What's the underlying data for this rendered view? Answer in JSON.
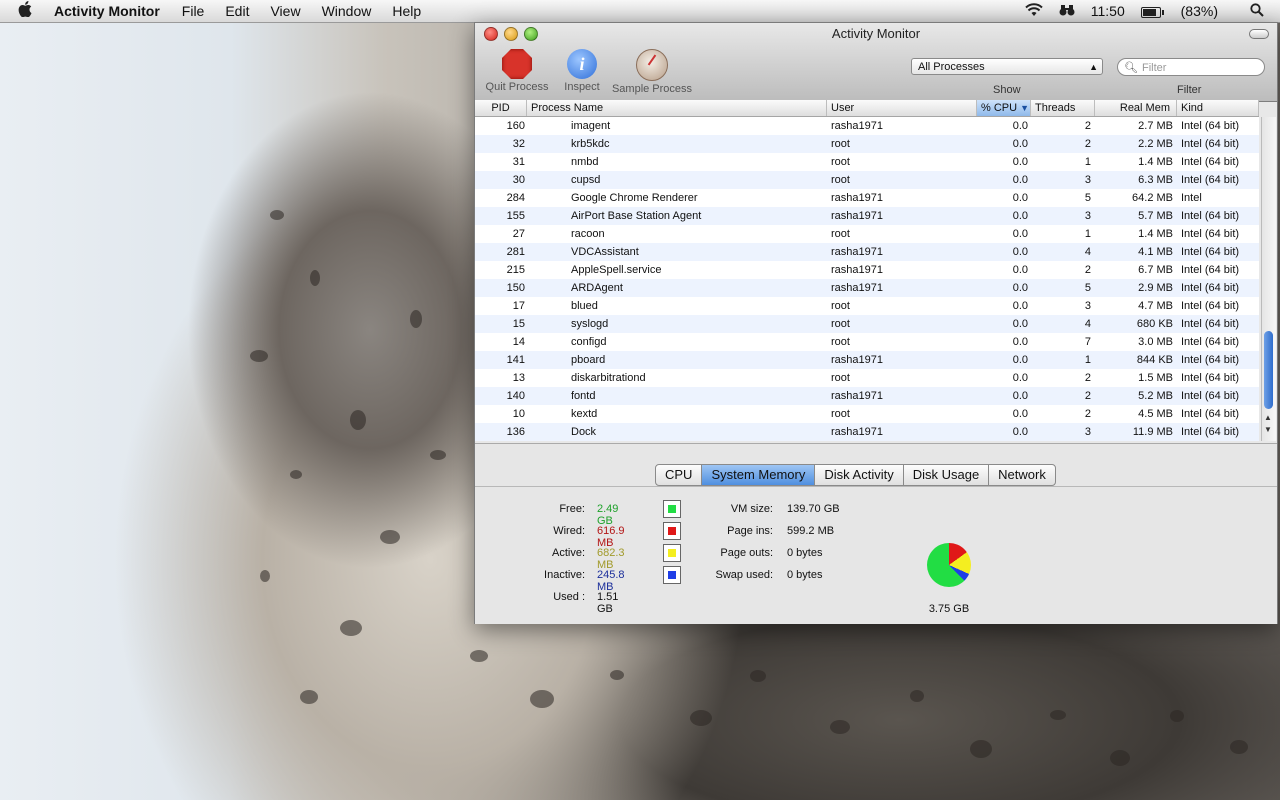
{
  "menubar": {
    "app": "Activity Monitor",
    "menus": [
      "File",
      "Edit",
      "View",
      "Window",
      "Help"
    ],
    "clock": "11:50",
    "battery": "(83%)",
    "battery_level": 0.83
  },
  "window": {
    "title": "Activity Monitor",
    "toolbar": {
      "quit": "Quit Process",
      "inspect": "Inspect",
      "sample": "Sample Process",
      "show_select": "All Processes",
      "filter_placeholder": "Filter",
      "show_label": "Show",
      "filter_label": "Filter"
    },
    "columns": [
      "PID",
      "Process Name",
      "User",
      "% CPU",
      "Threads",
      "Real Mem",
      "Kind"
    ],
    "sort_indicator": "▼",
    "rows": [
      {
        "pid": "160",
        "name": "imagent",
        "user": "rasha1971",
        "cpu": "0.0",
        "threads": "2",
        "mem": "2.7 MB",
        "kind": "Intel (64 bit)"
      },
      {
        "pid": "32",
        "name": "krb5kdc",
        "user": "root",
        "cpu": "0.0",
        "threads": "2",
        "mem": "2.2 MB",
        "kind": "Intel (64 bit)"
      },
      {
        "pid": "31",
        "name": "nmbd",
        "user": "root",
        "cpu": "0.0",
        "threads": "1",
        "mem": "1.4 MB",
        "kind": "Intel (64 bit)"
      },
      {
        "pid": "30",
        "name": "cupsd",
        "user": "root",
        "cpu": "0.0",
        "threads": "3",
        "mem": "6.3 MB",
        "kind": "Intel (64 bit)"
      },
      {
        "pid": "284",
        "name": "Google Chrome Renderer",
        "user": "rasha1971",
        "cpu": "0.0",
        "threads": "5",
        "mem": "64.2 MB",
        "kind": "Intel"
      },
      {
        "pid": "155",
        "name": "AirPort Base Station Agent",
        "user": "rasha1971",
        "cpu": "0.0",
        "threads": "3",
        "mem": "5.7 MB",
        "kind": "Intel (64 bit)"
      },
      {
        "pid": "27",
        "name": "racoon",
        "user": "root",
        "cpu": "0.0",
        "threads": "1",
        "mem": "1.4 MB",
        "kind": "Intel (64 bit)"
      },
      {
        "pid": "281",
        "name": "VDCAssistant",
        "user": "rasha1971",
        "cpu": "0.0",
        "threads": "4",
        "mem": "4.1 MB",
        "kind": "Intel (64 bit)"
      },
      {
        "pid": "215",
        "name": "AppleSpell.service",
        "user": "rasha1971",
        "cpu": "0.0",
        "threads": "2",
        "mem": "6.7 MB",
        "kind": "Intel (64 bit)"
      },
      {
        "pid": "150",
        "name": "ARDAgent",
        "user": "rasha1971",
        "cpu": "0.0",
        "threads": "5",
        "mem": "2.9 MB",
        "kind": "Intel (64 bit)"
      },
      {
        "pid": "17",
        "name": "blued",
        "user": "root",
        "cpu": "0.0",
        "threads": "3",
        "mem": "4.7 MB",
        "kind": "Intel (64 bit)"
      },
      {
        "pid": "15",
        "name": "syslogd",
        "user": "root",
        "cpu": "0.0",
        "threads": "4",
        "mem": "680 KB",
        "kind": "Intel (64 bit)"
      },
      {
        "pid": "14",
        "name": "configd",
        "user": "root",
        "cpu": "0.0",
        "threads": "7",
        "mem": "3.0 MB",
        "kind": "Intel (64 bit)"
      },
      {
        "pid": "141",
        "name": "pboard",
        "user": "rasha1971",
        "cpu": "0.0",
        "threads": "1",
        "mem": "844 KB",
        "kind": "Intel (64 bit)"
      },
      {
        "pid": "13",
        "name": "diskarbitrationd",
        "user": "root",
        "cpu": "0.0",
        "threads": "2",
        "mem": "1.5 MB",
        "kind": "Intel (64 bit)"
      },
      {
        "pid": "140",
        "name": "fontd",
        "user": "rasha1971",
        "cpu": "0.0",
        "threads": "2",
        "mem": "5.2 MB",
        "kind": "Intel (64 bit)"
      },
      {
        "pid": "10",
        "name": "kextd",
        "user": "root",
        "cpu": "0.0",
        "threads": "2",
        "mem": "4.5 MB",
        "kind": "Intel (64 bit)"
      },
      {
        "pid": "136",
        "name": "Dock",
        "user": "rasha1971",
        "cpu": "0.0",
        "threads": "3",
        "mem": "11.9 MB",
        "kind": "Intel (64 bit)"
      }
    ],
    "tabs": [
      "CPU",
      "System Memory",
      "Disk Activity",
      "Disk Usage",
      "Network"
    ],
    "active_tab": "System Memory",
    "memory": {
      "free": {
        "label": "Free:",
        "value": "2.49 GB",
        "color": "#1fa12b",
        "swatch": "#22dd44"
      },
      "wired": {
        "label": "Wired:",
        "value": "616.9 MB",
        "color": "#b31515",
        "swatch": "#e01818"
      },
      "active": {
        "label": "Active:",
        "value": "682.3 MB",
        "color": "#a19a2a",
        "swatch": "#f4ee20"
      },
      "inactive": {
        "label": "Inactive:",
        "value": "245.8 MB",
        "color": "#1c2f9b",
        "swatch": "#1f3ee6"
      },
      "used": {
        "label": "Used :",
        "value": "1.51 GB"
      },
      "vm_size": {
        "label": "VM size:",
        "value": "139.70 GB"
      },
      "page_ins": {
        "label": "Page ins:",
        "value": "599.2 MB"
      },
      "page_outs": {
        "label": "Page outs:",
        "value": "0 bytes"
      },
      "swap_used": {
        "label": "Swap used:",
        "value": "0 bytes"
      },
      "total": "3.75 GB"
    }
  }
}
